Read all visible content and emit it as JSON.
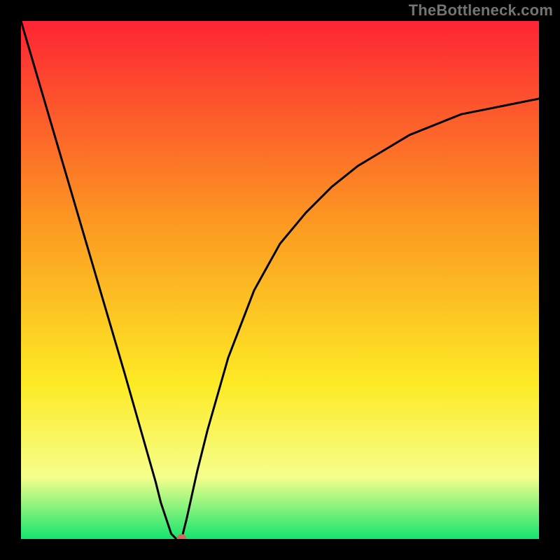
{
  "watermark": "TheBottleneck.com",
  "colors": {
    "gradient_top": "#fe2434",
    "gradient_mid1": "#fc9622",
    "gradient_mid2": "#fdea24",
    "gradient_mid3": "#f6ff8c",
    "gradient_bottom": "#14e56e",
    "frame": "#000000",
    "curve": "#000000",
    "marker": "#d66a5f"
  },
  "chart_data": {
    "type": "line",
    "title": "",
    "xlabel": "",
    "ylabel": "",
    "xlim": [
      0,
      100
    ],
    "ylim": [
      0,
      100
    ],
    "series": [
      {
        "name": "bottleneck-curve",
        "x": [
          0,
          5,
          10,
          15,
          20,
          22,
          24,
          26,
          27,
          28,
          29,
          30,
          31,
          32,
          34,
          36,
          40,
          45,
          50,
          55,
          60,
          65,
          70,
          75,
          80,
          85,
          90,
          95,
          100
        ],
        "y": [
          100,
          83,
          66,
          49,
          32,
          25,
          18,
          11,
          7,
          4,
          1,
          0,
          0,
          4,
          13,
          21,
          35,
          48,
          57,
          63,
          68,
          72,
          75,
          78,
          80,
          82,
          83,
          84,
          85
        ]
      }
    ],
    "marker": {
      "x": 31,
      "y": 0
    }
  }
}
